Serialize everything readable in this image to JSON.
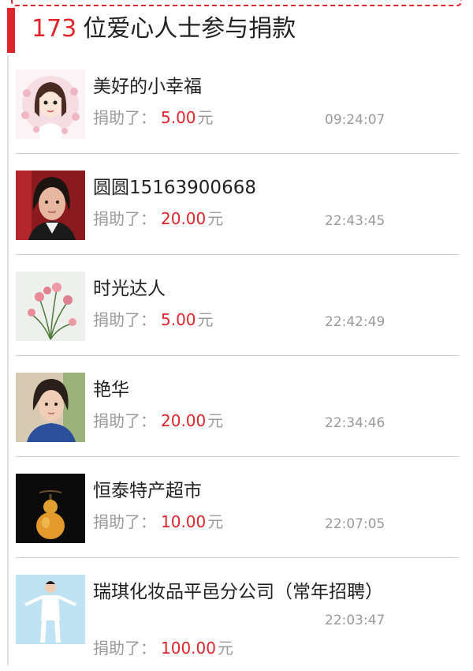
{
  "header": {
    "count": "173",
    "title": "位爱心人士参与捐款"
  },
  "donations": [
    {
      "name": "美好的小幸福",
      "donated_label": "捐助了：",
      "amount": "5.00",
      "unit": "元",
      "time": "09:24:07"
    },
    {
      "name": "圆圆15163900668",
      "donated_label": "捐助了：",
      "amount": "20.00",
      "unit": "元",
      "time": "22:43:45"
    },
    {
      "name": "时光达人",
      "donated_label": "捐助了：",
      "amount": "5.00",
      "unit": "元",
      "time": "22:42:49"
    },
    {
      "name": "艳华",
      "donated_label": "捐助了：",
      "amount": "20.00",
      "unit": "元",
      "time": "22:34:46"
    },
    {
      "name": "恒泰特产超市",
      "donated_label": "捐助了：",
      "amount": "10.00",
      "unit": "元",
      "time": "22:07:05"
    },
    {
      "name": "瑞琪化妆品平邑分公司（常年招聘）",
      "donated_label": "捐助了：",
      "amount": "100.00",
      "unit": "元",
      "time": "22:03:47"
    }
  ],
  "colors": {
    "accent": "#e0242c",
    "muted_text": "#9a9a9a",
    "divider": "#cfcfcf"
  }
}
